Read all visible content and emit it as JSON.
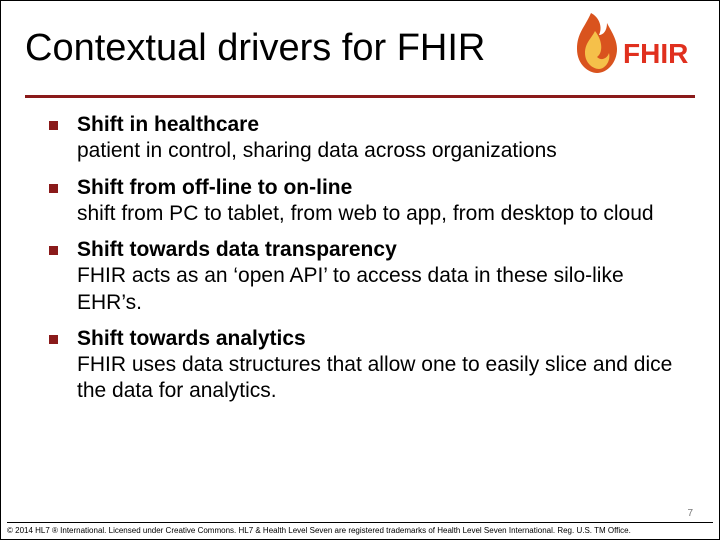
{
  "title": "Contextual drivers for FHIR",
  "logo_text": "FHIR",
  "bullets": [
    {
      "heading": "Shift in healthcare",
      "body": "patient in control, sharing data across organizations"
    },
    {
      "heading": "Shift from off-line to on-line",
      "body": "shift from PC to tablet, from web to app, from desktop to cloud"
    },
    {
      "heading": "Shift towards data transparency",
      "body": "FHIR acts as an ‘open API’ to access data in these silo-like EHR’s."
    },
    {
      "heading": "Shift towards analytics",
      "body": "FHIR uses data structures that allow one to easily slice and dice the data for analytics."
    }
  ],
  "page_number": "7",
  "footer": "© 2014 HL7 ® International. Licensed under Creative Commons. HL7 & Health Level Seven are registered trademarks of Health Level Seven International. Reg. U.S. TM Office."
}
